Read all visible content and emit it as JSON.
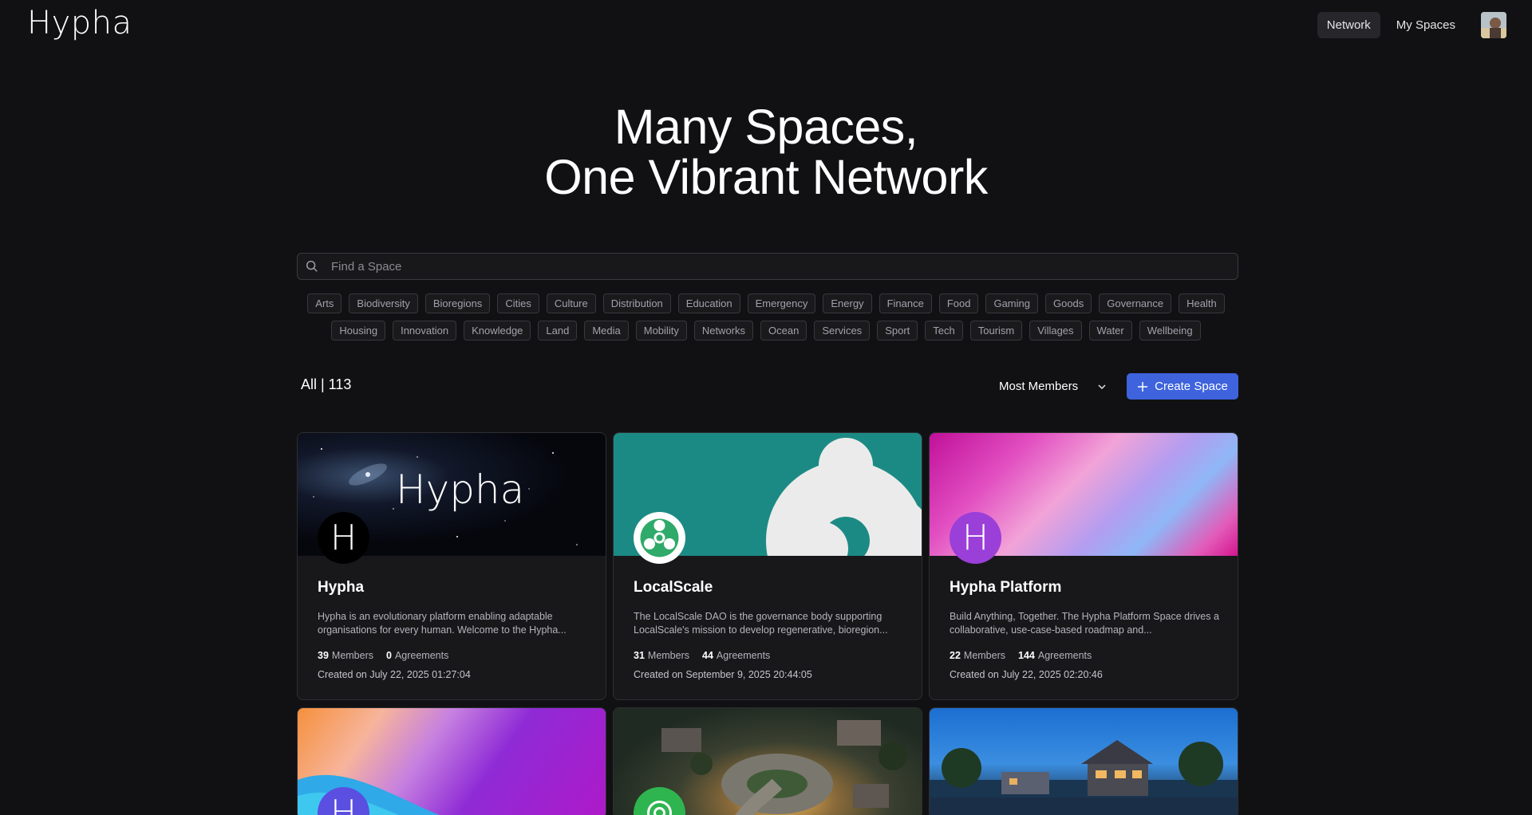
{
  "header": {
    "logo": "Hypha",
    "nav": {
      "network": "Network",
      "my_spaces": "My Spaces"
    }
  },
  "hero": {
    "line1": "Many Spaces,",
    "line2": "One Vibrant Network"
  },
  "search": {
    "placeholder": "Find a Space",
    "icon": "search-icon"
  },
  "tags_row1": [
    "Arts",
    "Biodiversity",
    "Bioregions",
    "Cities",
    "Culture",
    "Distribution",
    "Education",
    "Emergency",
    "Energy",
    "Finance",
    "Food",
    "Gaming",
    "Goods",
    "Governance",
    "Health"
  ],
  "tags_row2": [
    "Housing",
    "Innovation",
    "Knowledge",
    "Land",
    "Media",
    "Mobility",
    "Networks",
    "Ocean",
    "Services",
    "Sport",
    "Tech",
    "Tourism",
    "Villages",
    "Water",
    "Wellbeing"
  ],
  "toolbar": {
    "count": "All | 113",
    "sort": "Most Members",
    "create": "Create Space"
  },
  "colors": {
    "accent": "#3e63dd",
    "background": "#111113",
    "card": "#18181b",
    "localscale_teal": "#1c8a84",
    "platform_purple": "#9b3fd9"
  },
  "cards": [
    {
      "title": "Hypha",
      "cover_text": "Hypha",
      "icon_letter": "H",
      "description": "Hypha is an evolutionary platform enabling adaptable organisations for every human. Welcome to the Hypha...",
      "members": "39",
      "members_label": "Members",
      "agreements": "0",
      "agreements_label": "Agreements",
      "created": "Created on July 22, 2025 01:27:04"
    },
    {
      "title": "LocalScale",
      "description": "The LocalScale DAO is the governance body supporting LocalScale's mission to develop regenerative, bioregion...",
      "members": "31",
      "members_label": "Members",
      "agreements": "44",
      "agreements_label": "Agreements",
      "created": "Created on September 9, 2025 20:44:05"
    },
    {
      "title": "Hypha Platform",
      "icon_letter": "H",
      "description": "Build Anything, Together. The Hypha Platform Space drives a collaborative, use-case-based roadmap and...",
      "members": "22",
      "members_label": "Members",
      "agreements": "144",
      "agreements_label": "Agreements",
      "created": "Created on July 22, 2025 02:20:46"
    },
    {
      "icon_letter": "H"
    }
  ]
}
